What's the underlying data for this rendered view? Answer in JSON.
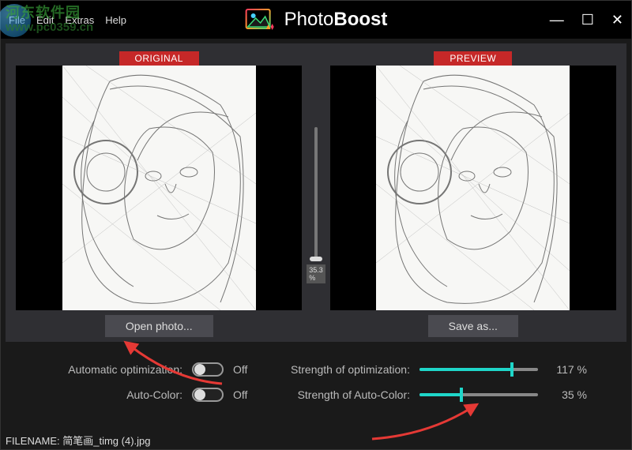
{
  "menubar": {
    "file": "File",
    "edit": "Edit",
    "extras": "Extras",
    "help": "Help"
  },
  "watermark": {
    "line1": "河东软件园",
    "line2": "www.pc0359.cn"
  },
  "app": {
    "name_light": "Photo",
    "name_bold": "Boost"
  },
  "window_controls": {
    "minimize": "—",
    "maximize": "☐",
    "close": "✕"
  },
  "compare": {
    "original_label": "ORIGINAL",
    "preview_label": "PREVIEW",
    "zoom_pct": "35.3 %",
    "open_btn": "Open photo...",
    "save_btn": "Save as..."
  },
  "controls": {
    "auto_opt_label": "Automatic optimization:",
    "auto_opt_state": "Off",
    "auto_color_label": "Auto-Color:",
    "auto_color_state": "Off",
    "strength_opt_label": "Strength of optimization:",
    "strength_opt_pct": "117 %",
    "strength_opt_fill": 78,
    "strength_color_label": "Strength of Auto-Color:",
    "strength_color_pct": "35 %",
    "strength_color_fill": 35
  },
  "filename": {
    "prefix": "FILENAME: ",
    "value": "简笔画_timg (4).jpg"
  }
}
